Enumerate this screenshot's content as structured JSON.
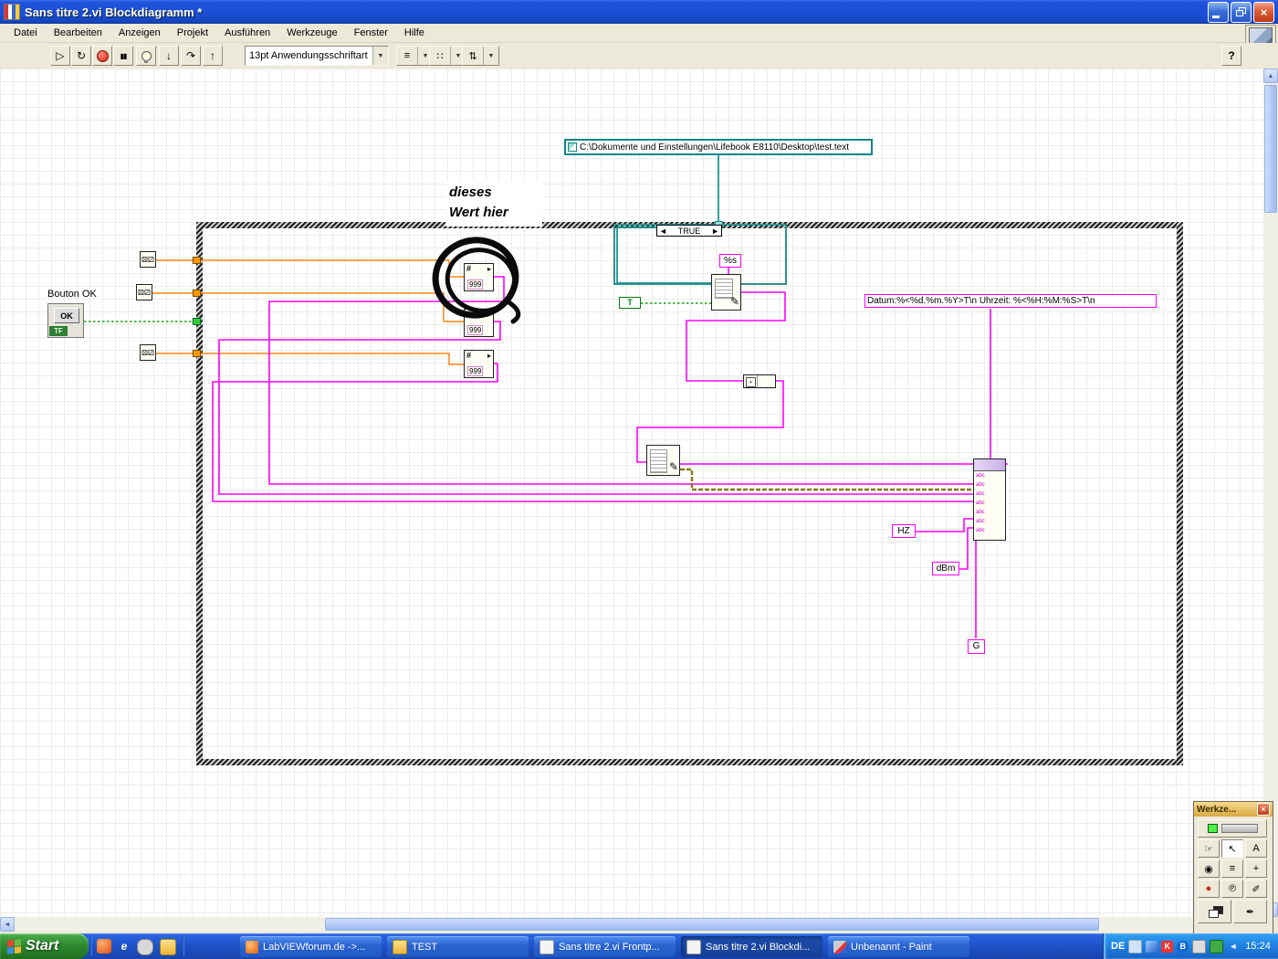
{
  "window": {
    "title": "Sans titre 2.vi Blockdiagramm *"
  },
  "menu": [
    "Datei",
    "Bearbeiten",
    "Anzeigen",
    "Projekt",
    "Ausführen",
    "Werkzeuge",
    "Fenster",
    "Hilfe"
  ],
  "toolbar": {
    "font": "13pt Anwendungsschriftart"
  },
  "icons": {
    "run": "▷",
    "run_cont": "↻",
    "pause": "▮▮",
    "step_into": "↓",
    "step_over": "↷",
    "step_out": "↑",
    "dropdown": "▼",
    "help": "?",
    "align": "≡",
    "distribute": "∷",
    "reorder": "⇅",
    "sel_l": "◄",
    "sel_r": "►",
    "up": "▲",
    "down": "▼",
    "left": "◄",
    "right": "►",
    "close": "×",
    "dice": "⚄⚂",
    "pencil": "✎",
    "arrow_small": "▸",
    "pal_operate": "☞",
    "pal_position": "↖",
    "pal_text": "A",
    "pal_wire": "◉",
    "pal_menu": "≡",
    "pal_scroll": "+",
    "pal_break": "●",
    "pal_probe": "℗",
    "pal_pick": "✐",
    "pal_brush": "✒",
    "ie_e": "e",
    "av_k": "K",
    "bt_b": "B"
  },
  "diagram": {
    "path_constant": "C:\\Dokumente und Einstellungen\\Lifebook E8110\\Desktop\\test.text",
    "case_selector": "TRUE",
    "format_string": "Datum:%<%d.%m.%Y>T\\n Uhrzeit: %<%H:%M:%S>T\\n",
    "percent_s": "%s",
    "true_constant": "T",
    "hz": "HZ",
    "dbm": "dBm",
    "g": "G",
    "annotation_line1": "dieses",
    "annotation_line2": "Wert hier",
    "ok_label": "Bouton OK",
    "ok_text": "OK",
    "ok_tf": "TF",
    "numconv_top": "#",
    "numconv_bottom": "999",
    "concat_row": "abc"
  },
  "palette": {
    "title": "Werkze..."
  },
  "taskbar": {
    "start": "Start",
    "tasks": [
      {
        "label": "LabVIEWforum.de ->..."
      },
      {
        "label": "TEST"
      },
      {
        "label": "Sans titre 2.vi Frontp..."
      },
      {
        "label": "Sans titre 2.vi Blockdi..."
      },
      {
        "label": "Unbenannt - Paint"
      }
    ],
    "tray": {
      "lang": "DE",
      "time": "15:24"
    }
  }
}
